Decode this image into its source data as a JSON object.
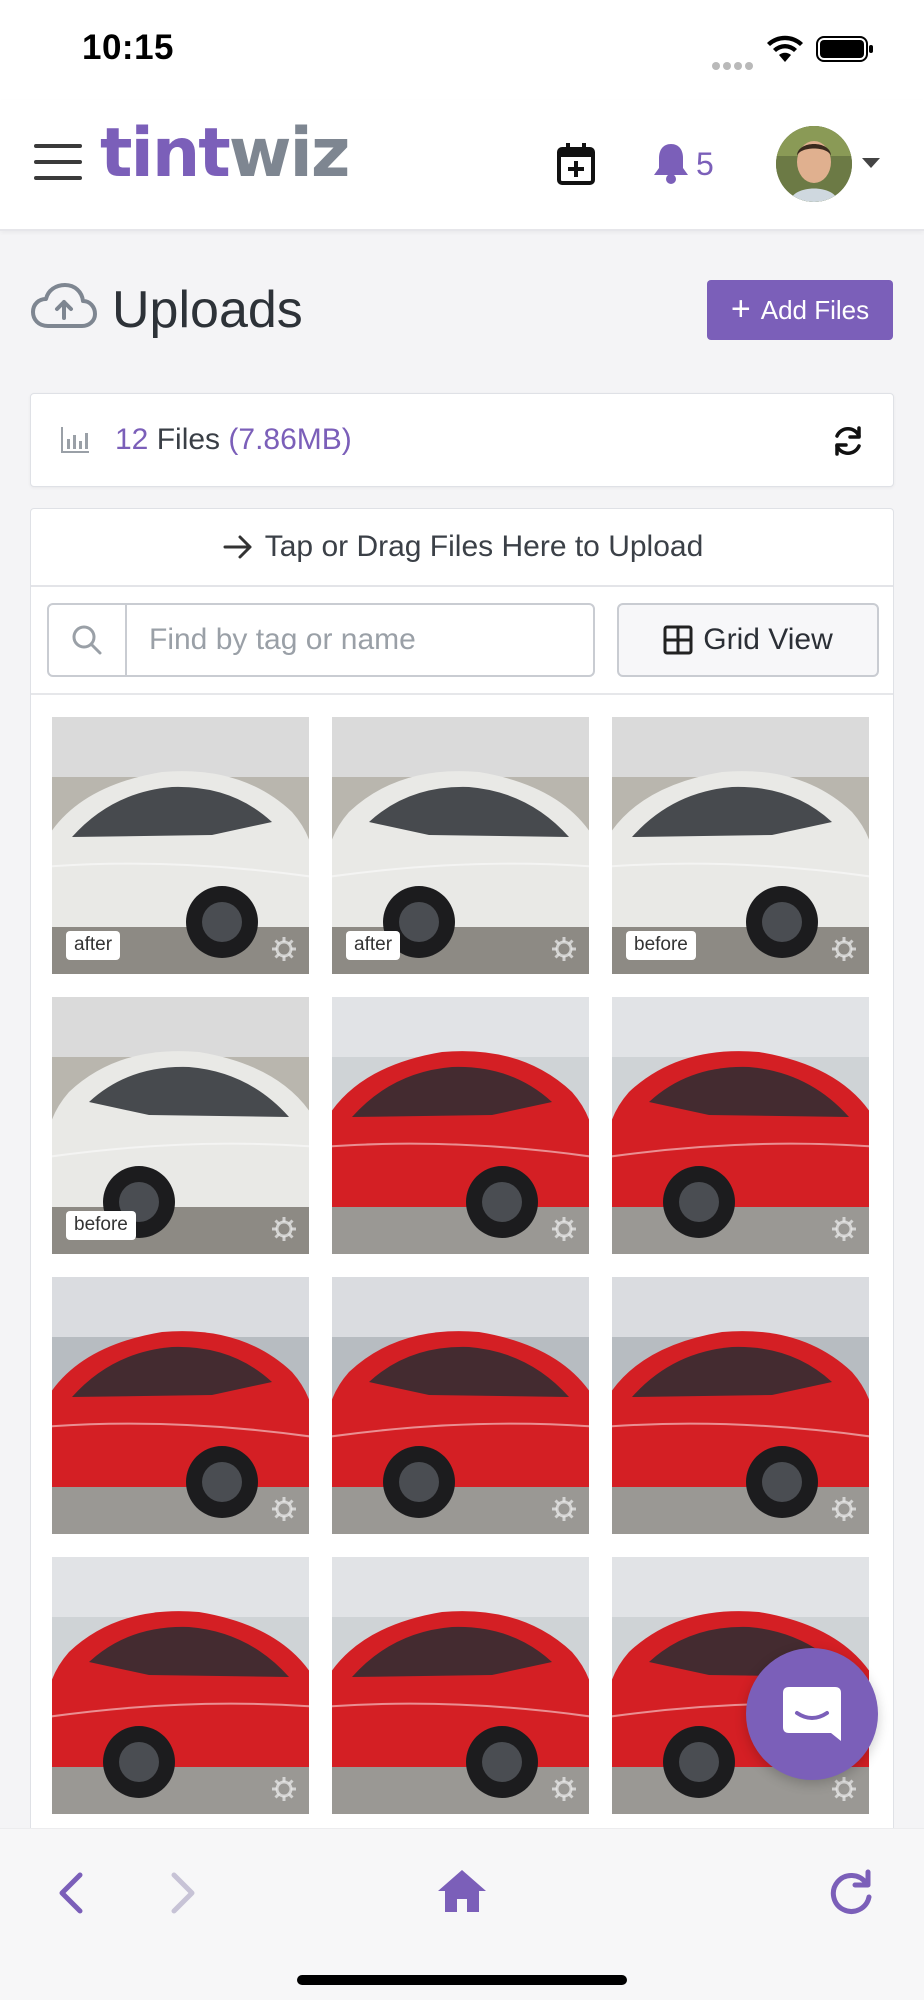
{
  "status_bar": {
    "time": "10:15"
  },
  "header": {
    "logo_part1": "tint",
    "logo_part2": "wiz",
    "notification_count": "5"
  },
  "page": {
    "title": "Uploads",
    "add_files_label": "Add Files"
  },
  "stats": {
    "file_count": "12",
    "files_word": "Files",
    "total_size": "(7.86MB)"
  },
  "upload": {
    "dropzone_text": "Tap or Drag Files Here to Upload",
    "search_placeholder": "Find by tag or name",
    "view_toggle_label": "Grid View"
  },
  "thumbnails": [
    {
      "tag": "after",
      "subject": "white car"
    },
    {
      "tag": "after",
      "subject": "white car open door"
    },
    {
      "tag": "before",
      "subject": "white car open door"
    },
    {
      "tag": "before",
      "subject": "white car"
    },
    {
      "tag": "",
      "subject": "red car"
    },
    {
      "tag": "",
      "subject": "red car"
    },
    {
      "tag": "",
      "subject": "red car"
    },
    {
      "tag": "",
      "subject": "red car"
    },
    {
      "tag": "",
      "subject": "red car"
    },
    {
      "tag": "",
      "subject": "red car"
    },
    {
      "tag": "",
      "subject": "red car"
    },
    {
      "tag": "",
      "subject": "red car"
    }
  ],
  "colors": {
    "brand_purple": "#7b5fb9",
    "logo_gray": "#7e8691",
    "car_white": "#e9e9e6",
    "car_red": "#d41f24"
  },
  "icons": [
    "menu-icon",
    "calendar-add-icon",
    "bell-icon",
    "cloud-upload-icon",
    "bar-chart-icon",
    "refresh-icon",
    "arrow-right-icon",
    "search-icon",
    "grid-icon",
    "gear-icon",
    "chat-icon",
    "back-icon",
    "forward-icon",
    "home-icon",
    "reload-icon"
  ]
}
